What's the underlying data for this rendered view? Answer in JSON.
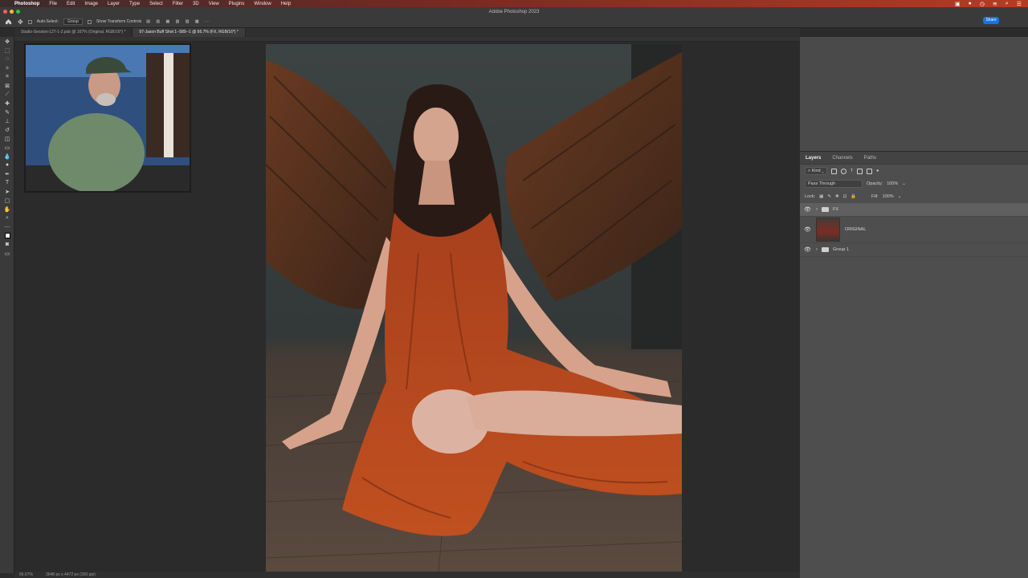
{
  "mac_menu": {
    "app": "Photoshop",
    "items": [
      "File",
      "Edit",
      "Image",
      "Layer",
      "Type",
      "Select",
      "Filter",
      "3D",
      "View",
      "Plugins",
      "Window",
      "Help"
    ]
  },
  "window": {
    "title": "Adobe Photoshop 2023"
  },
  "options_bar": {
    "auto_select_label": "Auto-Select:",
    "auto_select_value": "Group",
    "transform_controls_label": "Show Transform Controls",
    "share_label": "Share"
  },
  "tabs": [
    {
      "label": "Studio-Session-127-1-2.psb @ 167% (Original, RGB/16*) *",
      "active": false
    },
    {
      "label": "97-Jason Buff Shot 1--589--1 @ 66.7% (FX, RGB/16*) *",
      "active": true
    }
  ],
  "status_bar": {
    "zoom": "66.67%",
    "doc_info": "3648 px x 4472 px (300 ppi)"
  },
  "layers_panel": {
    "tabs": [
      "Layers",
      "Channels",
      "Paths"
    ],
    "filter_kind": "Kind",
    "blend_mode": "Pass Through",
    "opacity_label": "Opacity:",
    "opacity_value": "100%",
    "lock_label": "Lock:",
    "fill_label": "Fill:",
    "fill_value": "100%",
    "layers": [
      {
        "name": "FX",
        "type": "group",
        "selected": true
      },
      {
        "name": "ORIGINAL",
        "type": "pixel",
        "selected": false
      },
      {
        "name": "Group 1",
        "type": "group",
        "selected": false
      }
    ]
  },
  "colors": {
    "menubar_accent": "#b73b22",
    "share_button": "#1473e6",
    "dress": "#b4451f"
  }
}
